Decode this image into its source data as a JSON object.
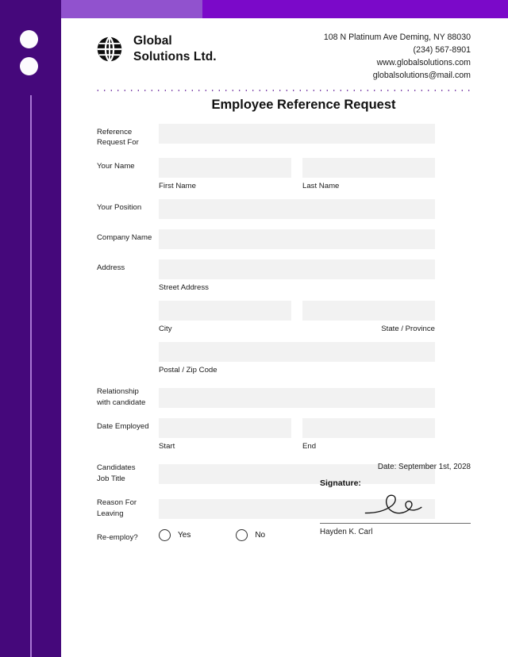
{
  "document": {
    "title": "Employee Reference Request"
  },
  "brand": {
    "logo_icon": "globe-icon",
    "name_line1": "Global",
    "name_line2": "Solutions Ltd."
  },
  "contact": {
    "address": "108 N Platinum Ave Deming, NY 88030",
    "phone": "(234) 567-8901",
    "website": "www.globalsolutions.com",
    "email": "globalsolutions@mail.com"
  },
  "form": {
    "reference_request_for": {
      "label": "Reference Request For",
      "value": ""
    },
    "your_name": {
      "label": "Your Name",
      "first_value": "",
      "last_value": "",
      "first_sub": "First Name",
      "last_sub": "Last Name"
    },
    "your_position": {
      "label": "Your Position",
      "value": ""
    },
    "company_name": {
      "label": "Company Name",
      "value": ""
    },
    "address": {
      "label": "Address",
      "street_value": "",
      "street_sub": "Street Address",
      "city_value": "",
      "city_sub": "City",
      "state_value": "",
      "state_sub": "State / Province",
      "postal_value": "",
      "postal_sub": "Postal / Zip Code"
    },
    "relationship": {
      "label_line1": "Relationship",
      "label_line2": "with candidate",
      "value": ""
    },
    "date_employed": {
      "label": "Date Employed",
      "start_value": "",
      "end_value": "",
      "start_sub": "Start",
      "end_sub": "End"
    },
    "candidates_job_title": {
      "label_line1": "Candidates",
      "label_line2": "Job Title",
      "value": ""
    },
    "reason_for_leaving": {
      "label_line1": "Reason For",
      "label_line2": "Leaving",
      "value": ""
    },
    "re_employ": {
      "label": "Re-employ?",
      "option_yes": "Yes",
      "option_no": "No",
      "selected": ""
    }
  },
  "signature": {
    "date": "Date: September 1st, 2028",
    "title": "Signature:",
    "mark_icon": "handwritten-signature-icon",
    "name": "Hayden K. Carl"
  },
  "colors": {
    "sidebar_dark_purple": "#45087B",
    "band_mid_purple": "#9152CE",
    "band_bright_purple": "#7B09C9",
    "divider_dot": "#5B1493",
    "field_fill": "#F2F2F2",
    "accent_line": "#A977D4"
  }
}
